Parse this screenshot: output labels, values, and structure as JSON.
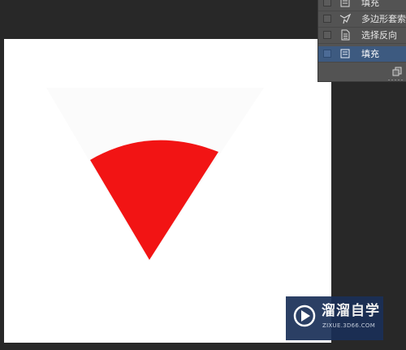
{
  "history_panel": {
    "items": [
      {
        "label": "填充",
        "icon": "fill-icon",
        "selected": false
      },
      {
        "label": "多边形套索",
        "icon": "polygon-lasso-icon",
        "selected": false
      },
      {
        "label": "选择反向",
        "icon": "inverse-selection-icon",
        "selected": false
      },
      {
        "label": "填充",
        "icon": "fill-icon",
        "selected": true
      }
    ],
    "footer_icon": "new-document-icon"
  },
  "canvas": {
    "background": "#ffffff",
    "shape_color": "#f21414",
    "shape": "sector"
  },
  "watermark": {
    "title": "溜溜自学",
    "url": "ZIXUE.3D66.COM",
    "logo_icon": "play-logo-icon",
    "background": "#1a2f57"
  },
  "colors": {
    "workspace": "#282828",
    "panel": "#535353",
    "selected_row": "#3d5a80"
  }
}
